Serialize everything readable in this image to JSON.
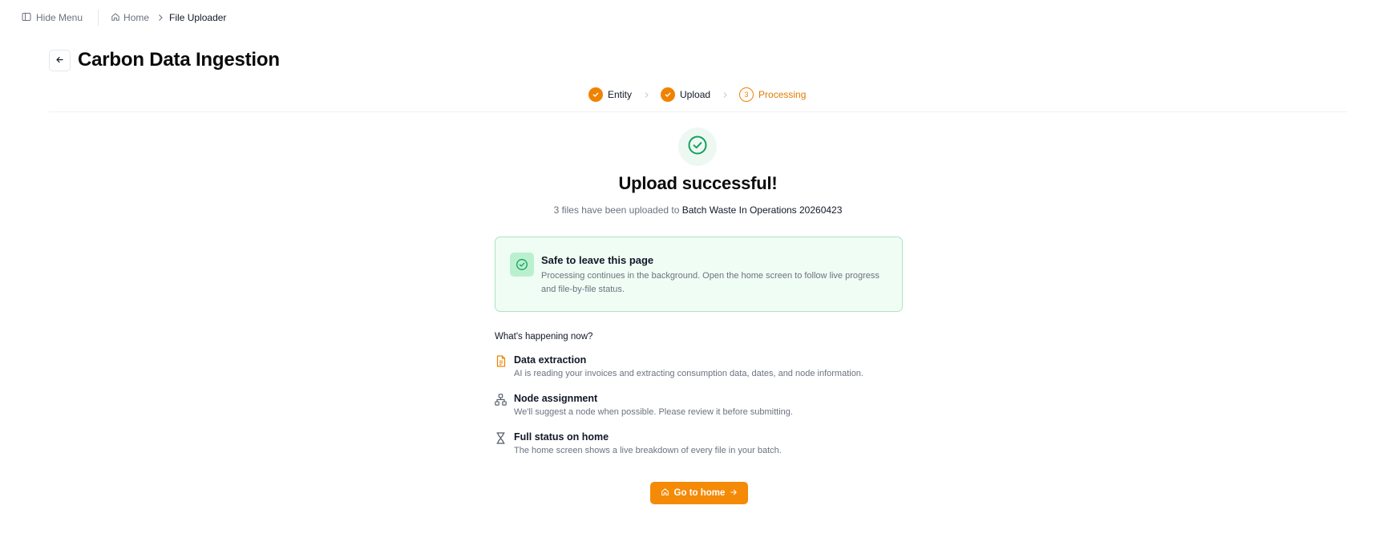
{
  "topbar": {
    "hide_menu_label": "Hide Menu",
    "breadcrumbs": [
      {
        "label": "Home",
        "icon": "home-icon"
      },
      {
        "label": "File Uploader"
      }
    ]
  },
  "header": {
    "title": "Carbon Data Ingestion"
  },
  "stepper": {
    "steps": [
      {
        "label": "Entity",
        "state": "done"
      },
      {
        "label": "Upload",
        "state": "done"
      },
      {
        "label": "Processing",
        "state": "current",
        "number": "3"
      }
    ]
  },
  "result": {
    "title": "Upload successful!",
    "subtitle_prefix": "3 files have been uploaded to ",
    "batch_name": "Batch Waste In Operations 20260423"
  },
  "notice": {
    "title": "Safe to leave this page",
    "text": "Processing continues in the background. Open the home screen to follow live progress and file-by-file status."
  },
  "happening": {
    "heading": "What's happening now?",
    "items": [
      {
        "icon": "document-icon",
        "title": "Data extraction",
        "desc": "AI is reading your invoices and extracting consumption data, dates, and node information."
      },
      {
        "icon": "node-tree-icon",
        "title": "Node assignment",
        "desc": "We'll suggest a node when possible. Please review it before submitting."
      },
      {
        "icon": "hourglass-icon",
        "title": "Full status on home",
        "desc": "The home screen shows a live breakdown of every file in your batch."
      }
    ]
  },
  "cta": {
    "label": "Go to home"
  },
  "colors": {
    "accent": "#f58a07",
    "success": "#12a05c",
    "success_bg": "#f0fdf4",
    "success_border": "#a8e6c0"
  }
}
